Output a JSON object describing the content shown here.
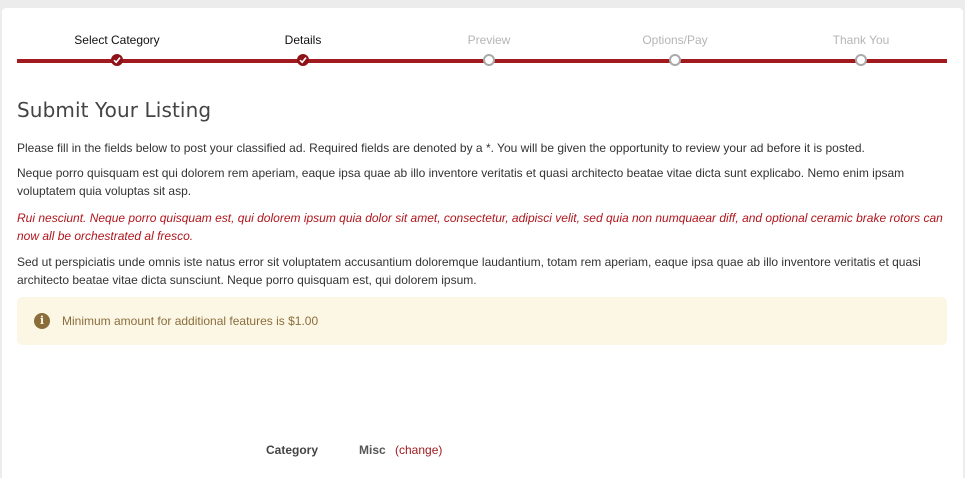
{
  "steps": [
    {
      "label": "Select Category",
      "state": "done"
    },
    {
      "label": "Details",
      "state": "done"
    },
    {
      "label": "Preview",
      "state": "todo"
    },
    {
      "label": "Options/Pay",
      "state": "todo"
    },
    {
      "label": "Thank You",
      "state": "todo"
    }
  ],
  "page": {
    "title": "Submit Your Listing",
    "intro": "Please fill in the fields below to post your classified ad. Required fields are denoted by a *. You will be given the opportunity to review your ad before it is posted.",
    "para1": "Neque porro quisquam est qui dolorem rem aperiam, eaque ipsa quae ab illo inventore veritatis et quasi architecto beatae vitae dicta sunt explicabo. Nemo enim ipsam voluptatem quia voluptas sit asp.",
    "para_red": "Rui nesciunt. Neque porro quisquam est, qui dolorem ipsum quia dolor sit amet, consectetur, adipisci velit, sed quia non numquaear diff, and optional ceramic brake rotors can now all be orchestrated al fresco.",
    "para2": "Sed ut perspiciatis unde omnis iste natus error sit voluptatem accusantium doloremque laudantium, totam rem aperiam, eaque ipsa quae ab illo inventore veritatis et quasi architecto beatae vitae dicta sunsciunt. Neque porro quisquam est, qui dolorem ipsum."
  },
  "alert": {
    "icon": "info-icon",
    "icon_glyph": "i",
    "text": "Minimum amount for additional features is $1.00",
    "color": "#8a6d3b",
    "background": "#fcf7e5"
  },
  "category": {
    "label": "Category",
    "value": "Misc",
    "change_label": "(change)"
  },
  "colors": {
    "accent": "#a11a1f"
  }
}
